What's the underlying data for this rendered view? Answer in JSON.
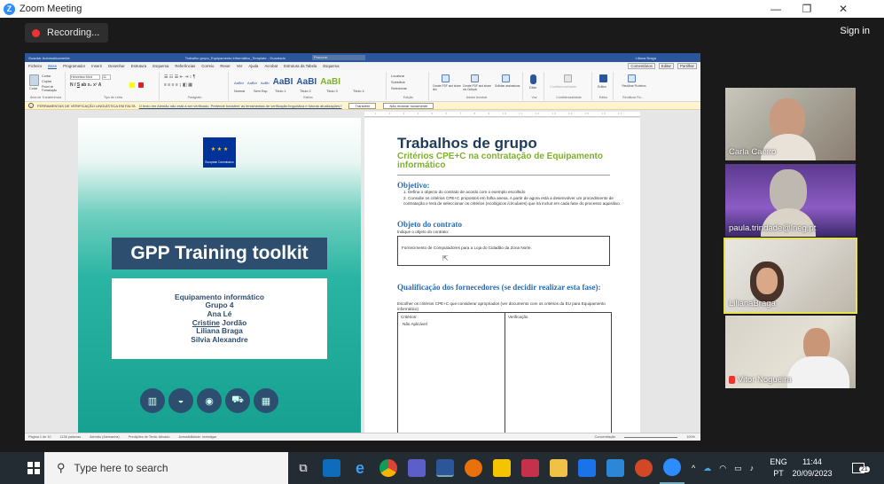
{
  "window": {
    "title": "Zoom Meeting",
    "minimize": "—",
    "maximize": "❐",
    "close": "✕"
  },
  "meeting": {
    "recording_label": "Recording...",
    "signin_label": "Sign in"
  },
  "word": {
    "title_left": "Guardar Automaticamente",
    "doc_name": "Trabalho grupo_Equipamento informático_Template - Guardado",
    "search_placeholder": "Procurar",
    "user": "Liliana Braga",
    "tabs": [
      "Ficheiro",
      "Base",
      "Programador",
      "Inserir",
      "Desenhar",
      "Estrutura",
      "Esquema",
      "Referências",
      "Correio",
      "Rever",
      "Ver",
      "Ajuda",
      "Acrobat",
      "Estrutura da Tabela",
      "Esquema"
    ],
    "active_tab": "Base",
    "right_buttons": [
      "Comentários",
      "Editar",
      "Partilhar"
    ],
    "ribbon": {
      "clipboard_label": "Área de Transferência",
      "paste": "Colar",
      "cut": "Cortar",
      "copy": "Copiar",
      "format_painter": "Pincel de Formatação",
      "font_group": "Tipo de Letra",
      "font_name": "Helvetica Med",
      "font_size": "11",
      "paragraph_group": "Parágrafo",
      "styles_group": "Estilos",
      "style_samples": [
        "AaBbI",
        "AaBbI",
        "AaBb",
        "AaBI",
        "AaBI",
        "AaBI"
      ],
      "style_names": [
        "Normal",
        "Sem Esp.",
        "Título 1",
        "Título 2",
        "Título 3",
        "Título 4"
      ],
      "editing_group": "Edição",
      "find": "Localizar",
      "replace": "Substituir",
      "select": "Selecionar",
      "acrobat_group": "Adobe Acrobat",
      "create_pdf": "Create PDF and share link",
      "create_pdf2": "Create PDF and share via Outlook",
      "request_sig": "Solicitar assinaturas",
      "voice_group": "Voz",
      "dictate": "Ditar",
      "sensitivity_group": "Confidencialidade",
      "sensitivity": "Confidencialidade",
      "editor_group": "Editor",
      "editor": "Editor",
      "reuse_group": "Reutilizar Fic...",
      "reuse": "Reutilizar Ficheiros"
    },
    "notice": {
      "label": "FERRAMENTAS DE VERIFICAÇÃO LINGUÍSTICA EM FALTA",
      "link": "O texto em Alemão não está a ser verificado. Pretende transferir as ferramentas de verificação linguística e futuras atualizações?",
      "btn1": "Transferir",
      "btn2": "Não mostrar novamente"
    },
    "cover": {
      "eu_label": "European Commission",
      "title": "GPP Training toolkit",
      "lines": [
        "Equipamento informático",
        "Grupo 4",
        "Ana Lé"
      ],
      "underlined": "Cristine",
      "underlined_rest": " Jordão",
      "lines2": [
        "Liliana Braga",
        "Silvia Alexandre"
      ]
    },
    "page2": {
      "title": "Trabalhos de grupo",
      "subtitle": "Critérios CPE+C na contratação de Equipamento informático",
      "objective_h": "Objetivo:",
      "objective_1": "1.   Defina o objecto do contrato de acordo com o exemplo escolhido",
      "objective_2": "2.   Consulte os critérios CPE+C propostos em folha anexa. A partir de agora está a desenvolver um procedimento de contratação e terá de seleccionar os critérios (ecológicos /circulares) que irá incluir em cada fase do processo aquisitivo.",
      "object_h": "Objeto do contrato",
      "object_hint": "Indique o objeto do contrato:",
      "object_value": "Fornecimento de Computadores para a Loja do Cidadão da Zona Norte.",
      "qual_h": "Qualificação dos fornecedores (se decidir realizar esta fase):",
      "qual_hint": "Escolher os critérios CPE+C que considerar apropriados (ver documento com os critérios da EU para Equipamento informático)",
      "col1": "Critérios:",
      "col2": "Verificação",
      "cell1": "Não Aplicável"
    },
    "status": {
      "page": "Página 1 de 10",
      "words": "1136 palavras",
      "lang": "Alemão (Alemanha)",
      "predict": "Predições de Texto: Ativado",
      "access": "Acessibilidade: investigar",
      "focus": "Concentração",
      "zoom": "100%"
    }
  },
  "participants": [
    {
      "name": "Carla Caeiro",
      "muted": false
    },
    {
      "name": "paula.trindade@lneg.pt",
      "muted": false
    },
    {
      "name": "LilianaBraga",
      "muted": false,
      "active": true
    },
    {
      "name": "Vitor Nogueira",
      "muted": true
    }
  ],
  "taskbar": {
    "search_placeholder": "Type here to search",
    "lang_top": "ENG",
    "lang_bottom": "PT",
    "time": "11:44",
    "date": "20/09/2023",
    "notifications": "21"
  }
}
